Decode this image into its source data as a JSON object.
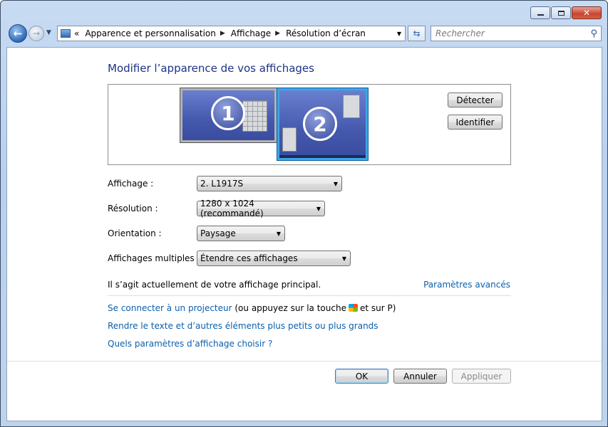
{
  "nav": {
    "recent_arrow": "▼",
    "breadcrumb_prefix": "«",
    "breadcrumbs": [
      "Apparence et personnalisation",
      "Affichage",
      "Résolution d’écran"
    ],
    "search_placeholder": "Rechercher"
  },
  "main": {
    "title": "Modifier l’apparence de vos affichages",
    "monitors": [
      {
        "number": "1",
        "selected": false
      },
      {
        "number": "2",
        "selected": true
      }
    ],
    "detect_button": "Détecter",
    "identify_button": "Identifier",
    "fields": {
      "display_label": "Affichage :",
      "display_value": "2. L1917S",
      "resolution_label": "Résolution :",
      "resolution_value": "1280 x 1024 (recommandé)",
      "orientation_label": "Orientation :",
      "orientation_value": "Paysage",
      "multiple_label": "Affichages multiples :",
      "multiple_value": "Étendre ces affichages"
    },
    "primary_info": "Il s’agit actuellement de votre affichage principal.",
    "advanced_link": "Paramètres avancés",
    "projector_link": "Se connecter à un projecteur",
    "projector_text_a": "(ou appuyez sur la touche",
    "projector_text_b": "et sur P)",
    "text_size_link": "Rendre le texte et d’autres éléments plus petits ou plus grands",
    "which_settings_link": "Quels paramètres d’affichage choisir ?"
  },
  "footer": {
    "ok": "OK",
    "cancel": "Annuler",
    "apply": "Appliquer"
  },
  "colors": {
    "title": "#1e3287",
    "link": "#0b5fab",
    "selected_monitor_border": "#3aa8e8"
  }
}
